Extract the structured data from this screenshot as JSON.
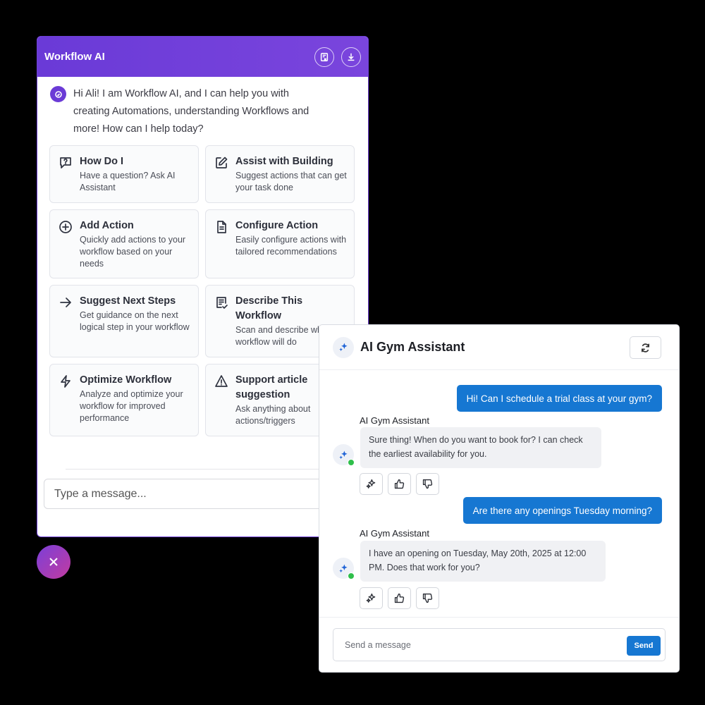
{
  "workflow_ai": {
    "title": "Workflow AI",
    "greeting": "Hi Ali!  I am Workflow AI, and I can help you with creating Automations, understanding Workflows and more! How can I help today?",
    "cards": [
      {
        "icon": "question-bubble-icon",
        "title": "How Do I",
        "description": "Have a question? Ask AI Assistant"
      },
      {
        "icon": "edit-square-icon",
        "title": "Assist with Building",
        "description": "Suggest actions that can get your task done"
      },
      {
        "icon": "plus-circle-icon",
        "title": "Add Action",
        "description": "Quickly add actions to your workflow based on your needs"
      },
      {
        "icon": "document-icon",
        "title": "Configure Action",
        "description": "Easily configure actions with tailored recommendations"
      },
      {
        "icon": "arrow-right-icon",
        "title": "Suggest Next Steps",
        "description": "Get guidance on the next logical step in your workflow"
      },
      {
        "icon": "checklist-doc-icon",
        "title": "Describe This Workflow",
        "description": "Scan and describe what this workflow will do"
      },
      {
        "icon": "lightning-icon",
        "title": "Optimize Workflow",
        "description": "Analyze and optimize your workflow for improved performance"
      },
      {
        "icon": "warning-triangle-icon",
        "title": "Support article suggestion",
        "description": "Ask anything about actions/triggers"
      }
    ],
    "input_placeholder": "Type a message..."
  },
  "gym_assistant": {
    "title": "AI Gym Assistant",
    "messages": [
      {
        "role": "user",
        "text": "Hi! Can I schedule a trial class at your gym?"
      },
      {
        "role": "bot",
        "name": "AI Gym Assistant",
        "text": "Sure thing! When do you want to book for? I can check the earliest availability for you."
      },
      {
        "role": "user",
        "text": "Are there any openings Tuesday morning?"
      },
      {
        "role": "bot",
        "name": "AI Gym Assistant",
        "text": "I have an opening on Tuesday, May 20th, 2025 at 12:00 PM. Does that work for you?"
      }
    ],
    "input_placeholder": "Send a message",
    "send_label": "Send"
  },
  "colors": {
    "workflow_header": "#6a3ad7",
    "gym_accent": "#1677d2",
    "online": "#2fbf4b"
  }
}
